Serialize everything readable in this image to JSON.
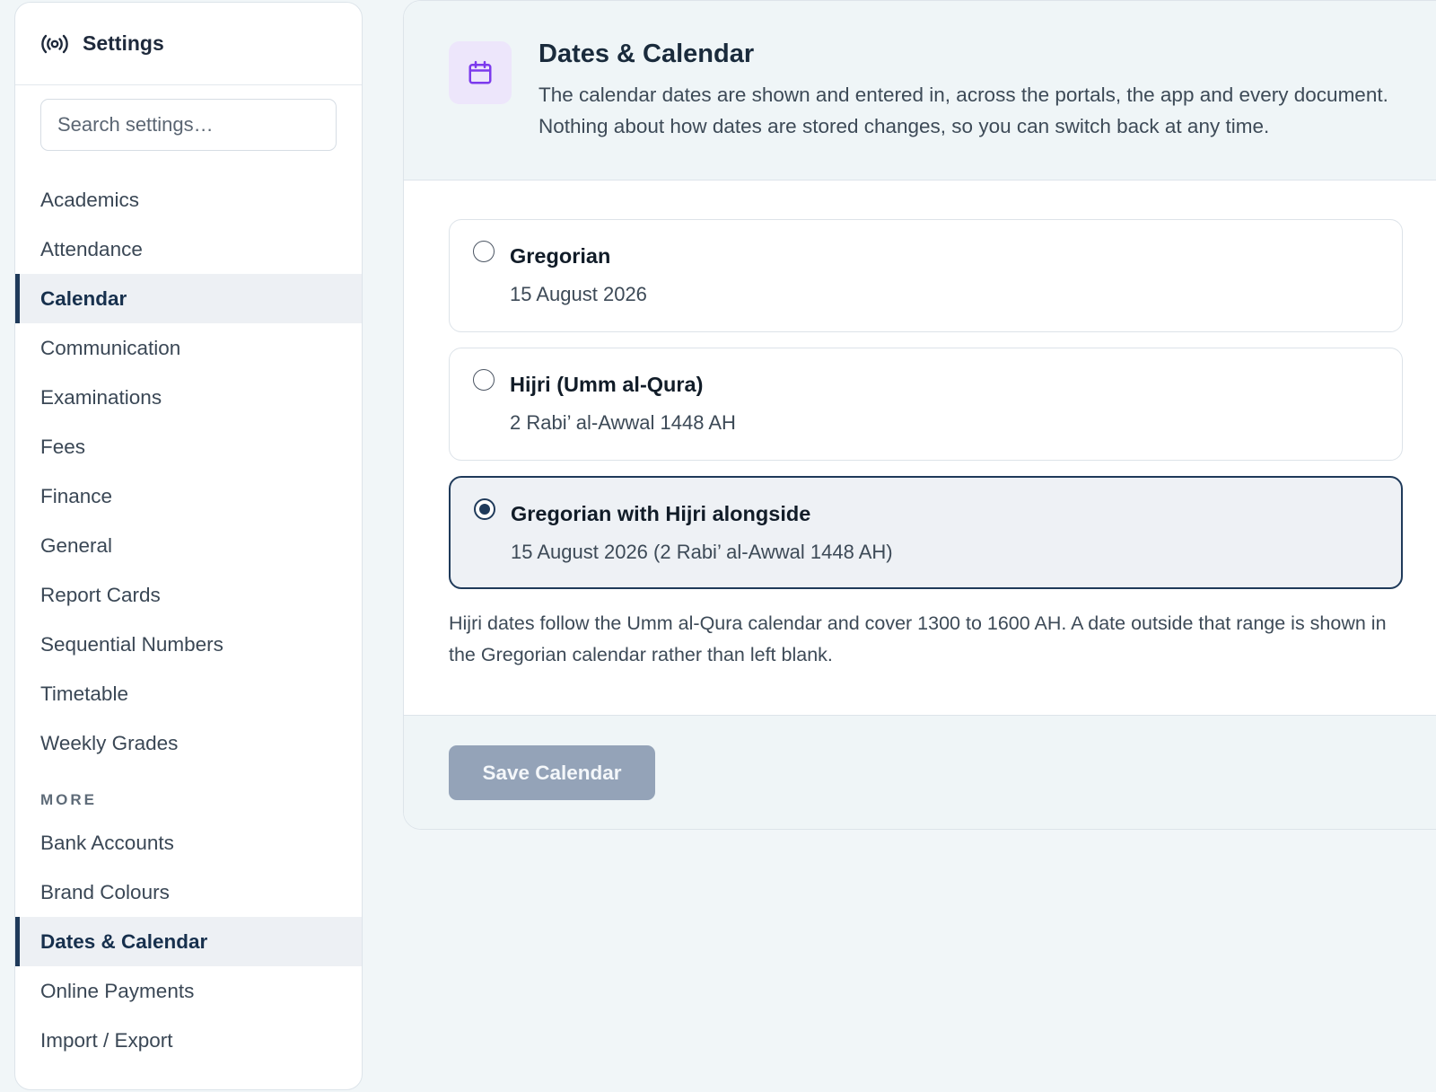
{
  "sidebar": {
    "title": "Settings",
    "icon": "broadcast-icon",
    "search": {
      "placeholder": "Search settings…",
      "value": ""
    },
    "items": [
      {
        "label": "Academics"
      },
      {
        "label": "Attendance"
      },
      {
        "label": "Calendar",
        "active": true
      },
      {
        "label": "Communication"
      },
      {
        "label": "Examinations"
      },
      {
        "label": "Fees"
      },
      {
        "label": "Finance"
      },
      {
        "label": "General"
      },
      {
        "label": "Report Cards"
      },
      {
        "label": "Sequential Numbers"
      },
      {
        "label": "Timetable"
      },
      {
        "label": "Weekly Grades"
      }
    ],
    "more_heading": "MORE",
    "more_items": [
      {
        "label": "Bank Accounts"
      },
      {
        "label": "Brand Colours"
      },
      {
        "label": "Dates & Calendar",
        "active": true
      },
      {
        "label": "Online Payments"
      },
      {
        "label": "Import / Export"
      }
    ]
  },
  "panel": {
    "icon": "calendar-icon",
    "title": "Dates & Calendar",
    "description": "The calendar dates are shown and entered in, across the portals, the app and every document. Nothing about how dates are stored changes, so you can switch back at any time.",
    "options": [
      {
        "title": "Gregorian",
        "example": "15 August 2026",
        "selected": false
      },
      {
        "title": "Hijri (Umm al-Qura)",
        "example": "2 Rabi’ al-Awwal 1448 AH",
        "selected": false
      },
      {
        "title": "Gregorian with Hijri alongside",
        "example": "15 August 2026 (2 Rabi’ al-Awwal 1448 AH)",
        "selected": true
      }
    ],
    "note": "Hijri dates follow the Umm al-Qura calendar and cover 1300 to 1600 AH. A date outside that range is shown in the Gregorian calendar rather than left blank.",
    "save_label": "Save Calendar"
  },
  "colors": {
    "accent": "#1f3a5a",
    "icon_purple": "#7c3aed",
    "icon_bg": "#ede6fb",
    "disabled_button": "#94a3b8",
    "page_bg": "#f1f6f8"
  }
}
